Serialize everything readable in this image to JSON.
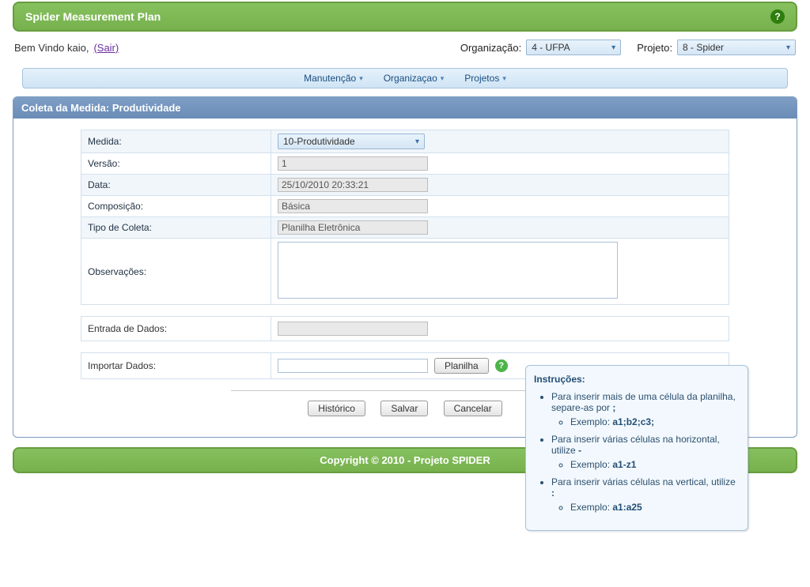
{
  "header": {
    "title": "Spider Measurement Plan"
  },
  "welcome": {
    "prefix": "Bem Vindo kaio, ",
    "sair": "(Sair)"
  },
  "top_selects": {
    "org_label": "Organização:",
    "org_value": "4 - UFPA",
    "proj_label": "Projeto:",
    "proj_value": "8 - Spider"
  },
  "menu": {
    "manutencao": "Manutenção",
    "organizacao": "Organizaçao",
    "projetos": "Projetos"
  },
  "panel": {
    "title": "Coleta da Medida: Produtividade"
  },
  "form": {
    "medida_label": "Medida:",
    "medida_value": "10-Produtividade",
    "versao_label": "Versão:",
    "versao_value": "1",
    "data_label": "Data:",
    "data_value": "25/10/2010 20:33:21",
    "composicao_label": "Composição:",
    "composicao_value": "Básica",
    "tipo_label": "Tipo de Coleta:",
    "tipo_value": "Planilha Eletrônica",
    "obs_label": "Observações:",
    "obs_value": ""
  },
  "entrada": {
    "label": "Entrada de Dados:",
    "value": ""
  },
  "importar": {
    "label": "Importar Dados:",
    "value": "",
    "btn": "Planilha"
  },
  "actions": {
    "historico": "Histórico",
    "salvar": "Salvar",
    "cancelar": "Cancelar"
  },
  "footer": {
    "text": "Copyright © 2010 - Projeto SPIDER"
  },
  "tooltip": {
    "title": "Instruções:",
    "li1_a": "Para inserir mais de uma célula da planilha, separe-as por ",
    "li1_b": ";",
    "li1_ex_a": "Exemplo: ",
    "li1_ex_b": "a1;b2;c3;",
    "li2_a": "Para inserir várias células na horizontal, utilize ",
    "li2_b": "-",
    "li2_ex_a": "Exemplo: ",
    "li2_ex_b": "a1-z1",
    "li3_a": "Para inserir várias células na vertical, utilize ",
    "li3_b": ":",
    "li3_ex_a": "Exemplo: ",
    "li3_ex_b": "a1:a25"
  }
}
